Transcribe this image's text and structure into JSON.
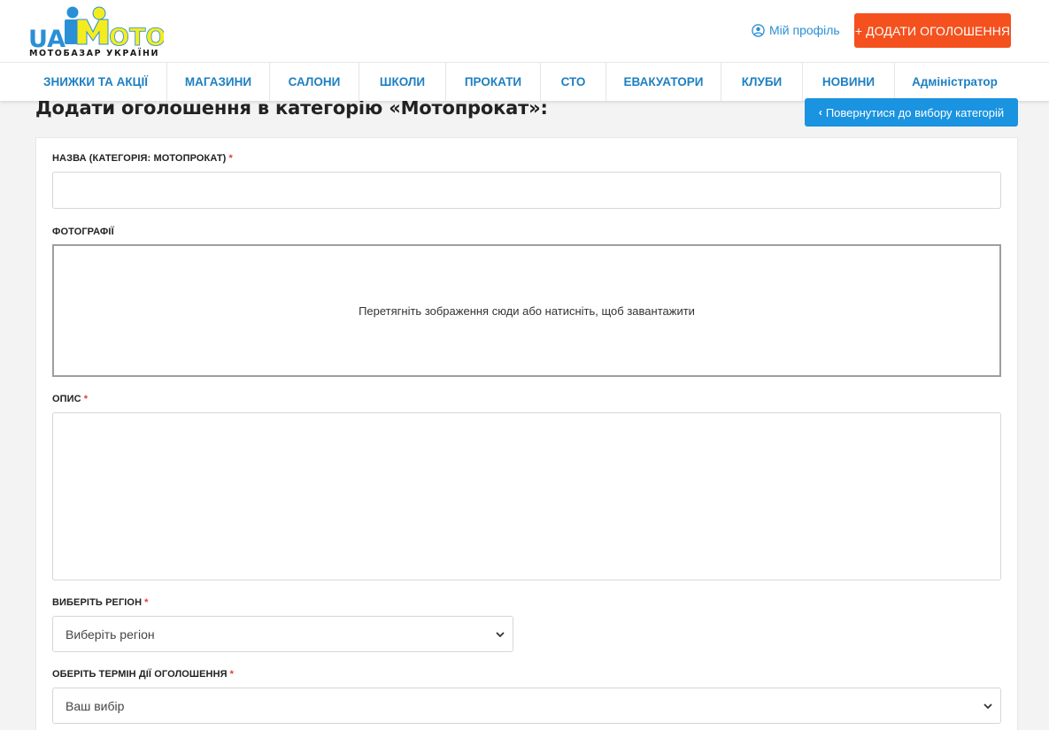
{
  "brand": {
    "logo_left": "UA",
    "logo_right": "OTO",
    "tagline": "МОТОБАЗАР УКРАЇНИ",
    "color_blue": "#2a8fd6",
    "color_yellow": "#f5ec1f"
  },
  "header": {
    "profile_label": "Мій профіль",
    "add_button_label": "+ ДОДАТИ ОГОЛОШЕННЯ",
    "add_button_color": "#f4511e"
  },
  "nav": {
    "items": [
      "ЗНИЖКИ ТА АКЦІЇ",
      "МАГАЗИНИ",
      "САЛОНИ",
      "ШКОЛИ",
      "ПРОКАТИ",
      "СТО",
      "ЕВАКУАТОРИ",
      "КЛУБИ",
      "НОВИНИ",
      "Адміністратор"
    ]
  },
  "page": {
    "title": "Додати оголошення в категорію «Мотопрокат»:",
    "back_button_label": "Повернутися до вибору категорій"
  },
  "form": {
    "name_label": "НАЗВА (КАТЕГОРІЯ: МОТОПРОКАТ)",
    "name_value": "",
    "photos_label": "ФОТОГРАФІЇ",
    "dropzone_text": "Перетягніть зображення сюди або натисніть, щоб завантажити",
    "description_label": "ОПИС",
    "description_value": "",
    "region_label": "ВИБЕРІТЬ РЕГІОН",
    "region_value": "Виберіть регіон",
    "term_label": "ОБЕРІТЬ ТЕРМІН ДІЇ ОГОЛОШЕННЯ",
    "term_value": "Ваш вибір",
    "required_mark": "*"
  }
}
